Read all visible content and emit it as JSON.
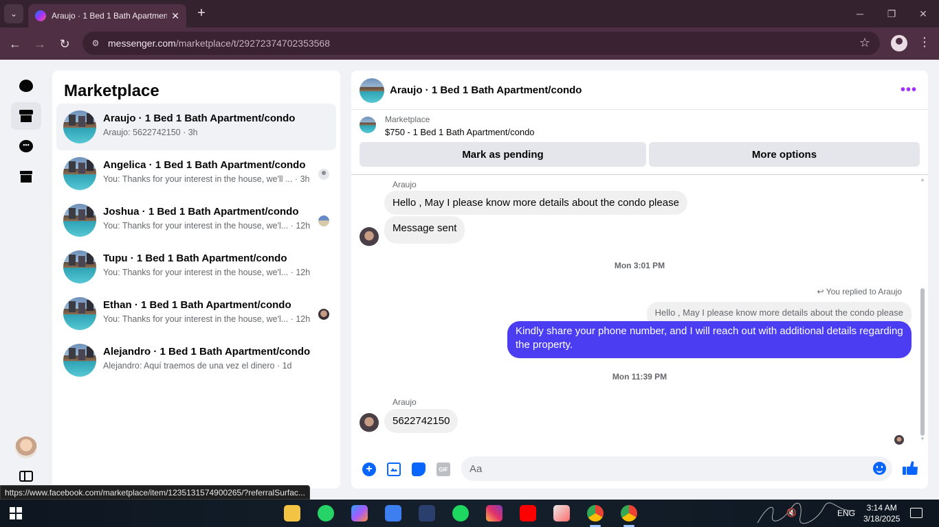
{
  "browser": {
    "tab_title": "Araujo · 1 Bed 1 Bath Apartment/condo",
    "url_host": "messenger.com",
    "url_path": "/marketplace/t/29272374702353568",
    "status_url": "https://www.facebook.com/marketplace/item/1235131574900265/?referralSurfac..."
  },
  "list": {
    "title": "Marketplace",
    "conversations": [
      {
        "title": "Araujo · 1 Bed 1 Bath Apartment/condo",
        "subtitle": "Araujo: 5622742150 · 3h"
      },
      {
        "title": "Angelica · 1 Bed 1 Bath Apartment/condo",
        "subtitle": "You: Thanks for your interest in the house, we'll ... · 3h"
      },
      {
        "title": "Joshua · 1 Bed 1 Bath Apartment/condo",
        "subtitle": "You: Thanks for your interest in the house, we'l... · 12h"
      },
      {
        "title": "Tupu · 1 Bed 1 Bath Apartment/condo",
        "subtitle": "You: Thanks for your interest in the house, we'l... · 12h"
      },
      {
        "title": "Ethan · 1 Bed 1 Bath Apartment/condo",
        "subtitle": "You: Thanks for your interest in the house, we'l... · 12h"
      },
      {
        "title": "Alejandro · 1 Bed 1 Bath Apartment/condo",
        "subtitle": "Alejandro: Aquí traemos de una vez el dinero · 1d"
      }
    ]
  },
  "chat": {
    "title": "Araujo · 1 Bed 1 Bath Apartment/condo",
    "listing_label": "Marketplace",
    "listing_price": "$750 - 1 Bed 1 Bath Apartment/condo",
    "mark_pending": "Mark as pending",
    "more_options": "More options",
    "sender1": "Araujo",
    "msg1": "Hello , May I please know more details about the condo please",
    "msg2": "Message sent",
    "time1": "Mon 3:01 PM",
    "reply_note": "You replied to Araujo",
    "quoted": "Hello , May I please know more details about the condo please",
    "out_msg": "Kindly share your phone number, and I will reach out with additional details regarding the property.",
    "time2": "Mon 11:39 PM",
    "sender2": "Araujo",
    "msg3": "5622742150",
    "input_placeholder": "Aa",
    "gif_label": "GIF"
  },
  "taskbar": {
    "lang": "ENG",
    "time": "3:14 AM",
    "date": "3/18/2025"
  },
  "colors": {
    "outgoing_bubble": "#4a3df2",
    "accent": "#0866ff",
    "browser_frame": "#4f2f43"
  }
}
